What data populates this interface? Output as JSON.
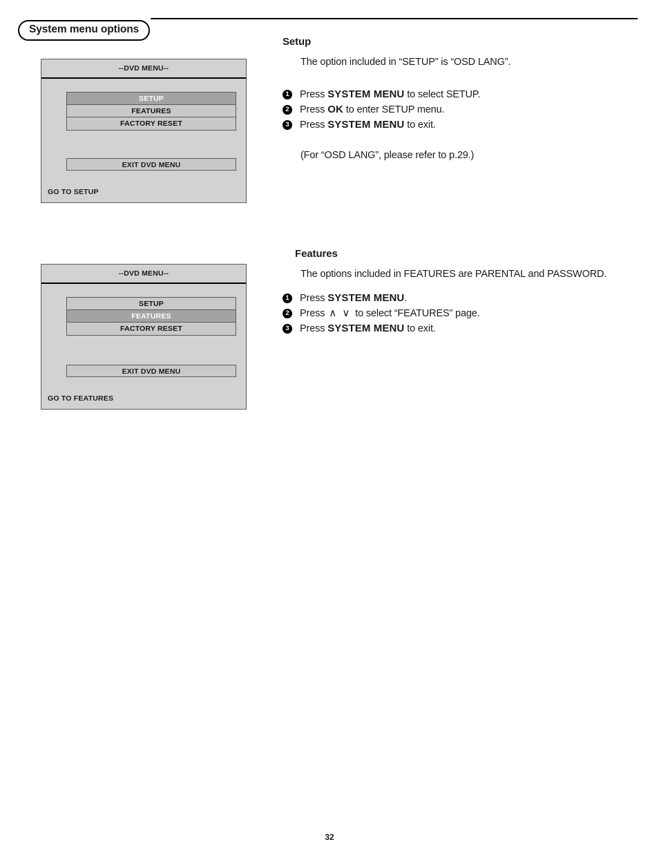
{
  "header": {
    "section_label": "System menu options"
  },
  "menu_screens": [
    {
      "title": "--DVD MENU--",
      "rows": [
        {
          "label": "SETUP",
          "selected": true
        },
        {
          "label": "FEATURES",
          "selected": false
        },
        {
          "label": "FACTORY RESET",
          "selected": false
        }
      ],
      "exit_label": "EXIT DVD MENU",
      "status": "GO TO SETUP"
    },
    {
      "title": "--DVD MENU--",
      "rows": [
        {
          "label": "SETUP",
          "selected": false
        },
        {
          "label": "FEATURES",
          "selected": true
        },
        {
          "label": "FACTORY RESET",
          "selected": false
        }
      ],
      "exit_label": "EXIT DVD MENU",
      "status": "GO TO FEATURES"
    }
  ],
  "setup": {
    "heading": "Setup",
    "lead": "The option included in “SETUP” is “OSD LANG”.",
    "steps": [
      {
        "num": "❶",
        "pre": "Press ",
        "kbd": "SYSTEM MENU",
        "post": " to select SETUP."
      },
      {
        "num": "❷",
        "pre": "Press ",
        "kbd": "OK",
        "post": " to enter SETUP menu."
      },
      {
        "num": "❸",
        "pre": "Press ",
        "kbd": "SYSTEM MENU",
        "post": " to exit."
      }
    ],
    "note": "(For “OSD LANG”, please refer to p.29.)"
  },
  "features": {
    "heading": "Features",
    "lead": "The options included in FEATURES are PARENTAL and PASSWORD.",
    "steps": [
      {
        "num": "❶",
        "pre": "Press ",
        "kbd": "SYSTEM MENU",
        "post": "."
      },
      {
        "num": "❷",
        "pre": "Press ",
        "arrows": "∧  ∨",
        "post": " to select “FEATURES” page."
      },
      {
        "num": "❸",
        "pre": "Press ",
        "kbd": "SYSTEM MENU",
        "post": " to exit."
      }
    ]
  },
  "footer": {
    "page_number": "32"
  },
  "step_numbers": [
    "1",
    "2",
    "3"
  ]
}
